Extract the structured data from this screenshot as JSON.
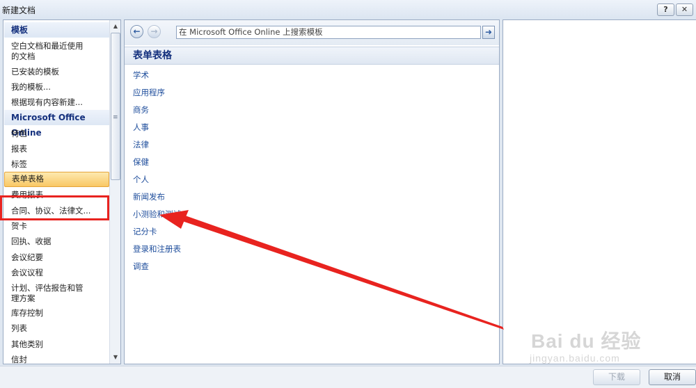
{
  "window": {
    "title": "新建文档",
    "help_label": "?",
    "close_label": "✕"
  },
  "left_panel": {
    "sections": [
      {
        "kind": "head",
        "label": "模板"
      },
      {
        "kind": "item",
        "label": "空白文档和最近使用"
      },
      {
        "kind": "item",
        "label": "的文档"
      },
      {
        "kind": "item",
        "label": "已安装的模板"
      },
      {
        "kind": "item",
        "label": "我的模板..."
      },
      {
        "kind": "item",
        "label": "根据现有内容新建..."
      },
      {
        "kind": "head",
        "label": "Microsoft Office Online"
      },
      {
        "kind": "item",
        "label": "特色"
      },
      {
        "kind": "item",
        "label": "报表"
      },
      {
        "kind": "item",
        "label": "标签"
      },
      {
        "kind": "item",
        "label": "表单表格",
        "selected": true
      },
      {
        "kind": "item",
        "label": "费用报表"
      },
      {
        "kind": "item",
        "label": "合同、协议、法律文..."
      },
      {
        "kind": "item",
        "label": "贺卡"
      },
      {
        "kind": "item",
        "label": "回执、收据"
      },
      {
        "kind": "item",
        "label": "会议纪要"
      },
      {
        "kind": "item",
        "label": "会议议程"
      },
      {
        "kind": "item",
        "label": "计划、评估报告和管"
      },
      {
        "kind": "item",
        "label": "理方案"
      },
      {
        "kind": "item",
        "label": "库存控制"
      },
      {
        "kind": "item",
        "label": "列表"
      },
      {
        "kind": "item",
        "label": "其他类别"
      },
      {
        "kind": "item",
        "label": "信封"
      }
    ],
    "scroll_up": "▲",
    "scroll_down": "▼",
    "scroll_grip": "≡"
  },
  "nav": {
    "back_icon": "←",
    "forward_icon": "→",
    "go_icon": "➜",
    "search_placeholder": "在 Microsoft Office Online 上搜索模板"
  },
  "category": {
    "title": "表单表格",
    "links": [
      "学术",
      "应用程序",
      "商务",
      "人事",
      "法律",
      "保健",
      "个人",
      "新闻发布",
      "小测验和测试",
      "记分卡",
      "登录和注册表",
      "调查"
    ]
  },
  "watermark": {
    "text": "Bai du 经验",
    "url": "jingyan.baidu.com"
  },
  "buttons": {
    "download": "下载",
    "cancel": "取消"
  },
  "annotation": {
    "box_color": "#e8231f",
    "arrow_color": "#e8231f"
  }
}
